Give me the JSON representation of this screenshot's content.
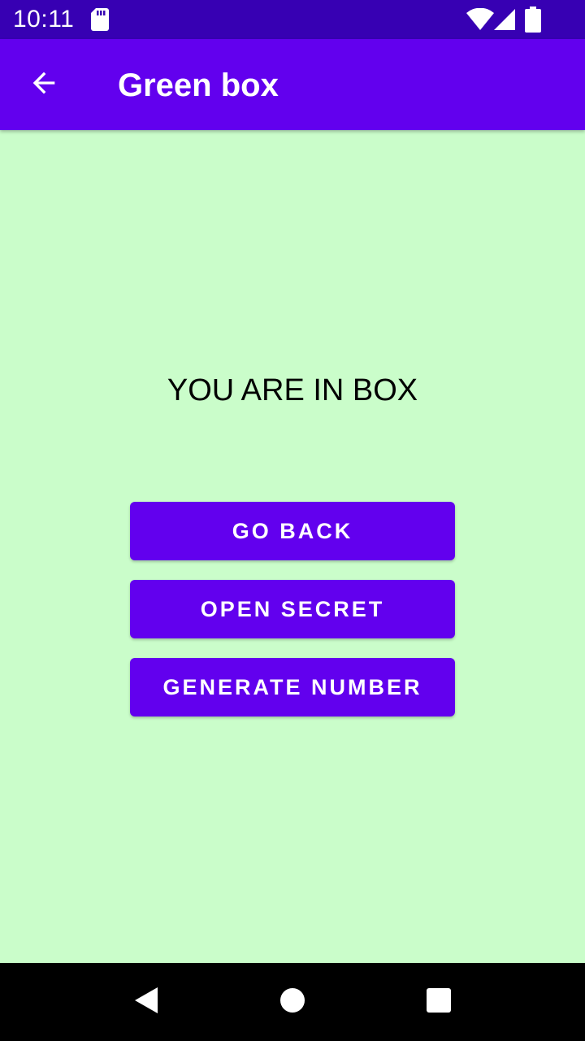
{
  "status_bar": {
    "time": "10:11",
    "icons": [
      "sd-card-icon",
      "wifi-icon",
      "cell-signal-icon",
      "battery-icon"
    ],
    "background": "#3700B3"
  },
  "app_bar": {
    "title": "Green box",
    "nav_icon": "back-arrow-icon",
    "background": "#6200EE"
  },
  "content": {
    "message": "YOU ARE IN BOX",
    "background": "#CAFDCA",
    "buttons": [
      {
        "label": "GO BACK"
      },
      {
        "label": "OPEN SECRET"
      },
      {
        "label": "GENERATE NUMBER"
      }
    ],
    "button_color": "#6200EE"
  },
  "nav_bar": {
    "icons": [
      "nav-back-icon",
      "nav-home-icon",
      "nav-recents-icon"
    ]
  }
}
